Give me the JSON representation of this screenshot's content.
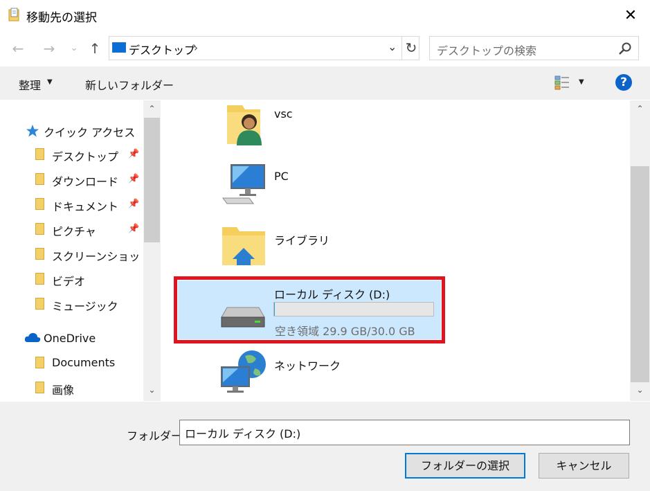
{
  "window": {
    "title": "移動先の選択",
    "close_glyph": "✕"
  },
  "nav": {
    "back_glyph": "←",
    "forward_glyph": "→",
    "recent_glyph": "⌄",
    "up_glyph": "↑",
    "address": {
      "icon": "desktop-icon",
      "text": "デスクトップ",
      "chevron": "›",
      "dropdown_glyph": "⌄",
      "refresh_glyph": "↻"
    },
    "search": {
      "placeholder": "デスクトップの検索",
      "icon": "search-icon"
    }
  },
  "toolbar": {
    "organize_label": "整理",
    "organize_caret": "▼",
    "new_folder_label": "新しいフォルダー",
    "view_caret": "▼",
    "help_glyph": "?"
  },
  "sidebar": {
    "quick_access_label": "クイック アクセス",
    "items": [
      {
        "label": "デスクトップ",
        "icon": "desktop-folder-icon",
        "pinned": true
      },
      {
        "label": "ダウンロード",
        "icon": "download-folder-icon",
        "pinned": true
      },
      {
        "label": "ドキュメント",
        "icon": "documents-folder-icon",
        "pinned": true
      },
      {
        "label": "ピクチャ",
        "icon": "pictures-folder-icon",
        "pinned": true
      },
      {
        "label": "スクリーンショット",
        "icon": "folder-icon",
        "pinned": false
      },
      {
        "label": "ビデオ",
        "icon": "video-folder-icon",
        "pinned": false
      },
      {
        "label": "ミュージック",
        "icon": "music-folder-icon",
        "pinned": false
      }
    ],
    "onedrive_label": "OneDrive",
    "onedrive_items": [
      {
        "label": "Documents",
        "icon": "folder-icon"
      },
      {
        "label": "画像",
        "icon": "folder-icon"
      }
    ],
    "pin_glyph": "📌",
    "scroll_up": "⌃",
    "scroll_down": "⌄"
  },
  "main": {
    "items": [
      {
        "label": "vsc",
        "icon": "user-folder-icon"
      },
      {
        "label": "PC",
        "icon": "computer-icon"
      },
      {
        "label": "ライブラリ",
        "icon": "library-icon"
      },
      {
        "label": "ローカル ディスク (D:)",
        "icon": "drive-icon",
        "selected": true,
        "free_space": "空き領域 29.9 GB/30.0 GB",
        "used_fraction": 0.003
      },
      {
        "label": "ネットワーク",
        "icon": "network-icon"
      }
    ],
    "scroll_up": "⌃",
    "scroll_down": "⌄",
    "selection_color": "#e0141e"
  },
  "footer": {
    "folder_label": "フォルダー:",
    "folder_value": "ローカル ディスク (D:)",
    "ok_label": "フォルダーの選択",
    "cancel_label": "キャンセル"
  }
}
